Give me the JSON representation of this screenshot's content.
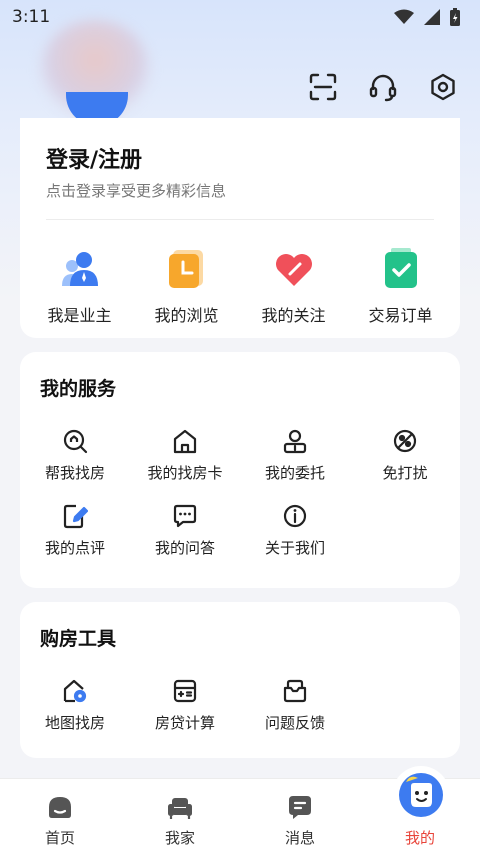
{
  "status_bar": {
    "time": "3:11"
  },
  "top_actions": {
    "icons": [
      "scan-icon",
      "headset-icon",
      "settings-hex-icon"
    ]
  },
  "login": {
    "title": "登录/注册",
    "subtitle": "点击登录享受更多精彩信息"
  },
  "quick_actions": [
    {
      "label": "我是业主",
      "icon": "owner-icon"
    },
    {
      "label": "我的浏览",
      "icon": "history-icon"
    },
    {
      "label": "我的关注",
      "icon": "heart-icon"
    },
    {
      "label": "交易订单",
      "icon": "order-icon"
    }
  ],
  "services": {
    "title": "我的服务",
    "items": [
      {
        "label": "帮我找房",
        "icon": "find-home-icon"
      },
      {
        "label": "我的找房卡",
        "icon": "house-card-icon"
      },
      {
        "label": "我的委托",
        "icon": "person-icon"
      },
      {
        "label": "免打扰",
        "icon": "do-not-disturb-icon"
      },
      {
        "label": "我的点评",
        "icon": "edit-icon"
      },
      {
        "label": "我的问答",
        "icon": "chat-icon"
      },
      {
        "label": "关于我们",
        "icon": "info-icon"
      }
    ]
  },
  "tools": {
    "title": "购房工具",
    "items": [
      {
        "label": "地图找房",
        "icon": "map-home-icon"
      },
      {
        "label": "房贷计算",
        "icon": "calculator-icon"
      },
      {
        "label": "问题反馈",
        "icon": "feedback-icon"
      }
    ]
  },
  "tabs": [
    {
      "label": "首页",
      "icon": "home-icon"
    },
    {
      "label": "我家",
      "icon": "sofa-icon"
    },
    {
      "label": "消息",
      "icon": "message-icon"
    },
    {
      "label": "我的",
      "icon": "mascot-icon",
      "active": true
    }
  ],
  "colors": {
    "accent_blue": "#3d7bf0",
    "active_red": "#e8443a",
    "orange": "#f7a72c",
    "green": "#23c28a",
    "heart_red": "#f0505a"
  }
}
